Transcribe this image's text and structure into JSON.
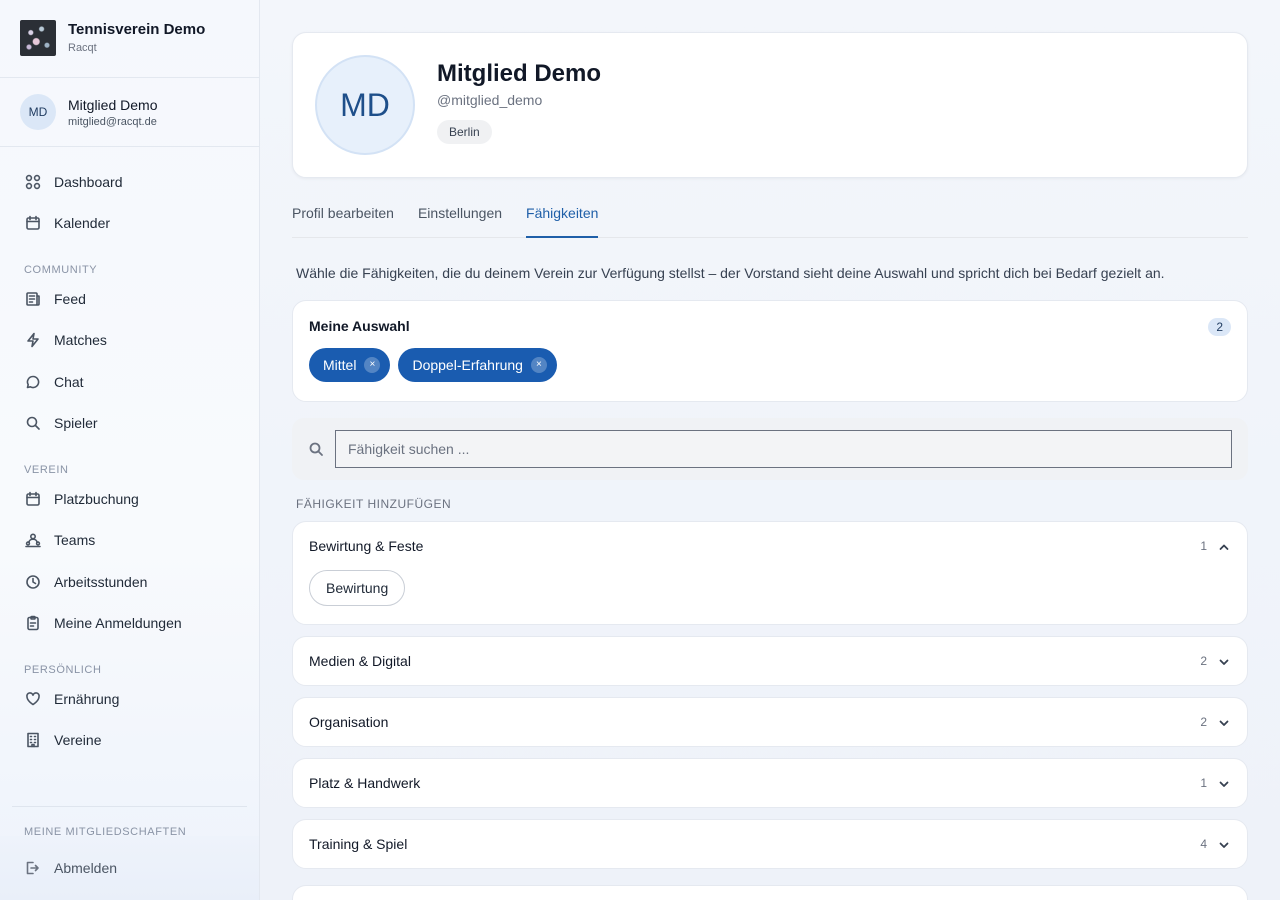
{
  "club": {
    "name": "Tennisverein Demo",
    "sub": "Racqt"
  },
  "user": {
    "initials": "MD",
    "name": "Mitglied Demo",
    "email": "mitglied@racqt.de"
  },
  "nav": {
    "top": [
      {
        "label": "Dashboard",
        "icon": "dashboard-icon"
      },
      {
        "label": "Kalender",
        "icon": "calendar-icon"
      }
    ],
    "community_label": "COMMUNITY",
    "community": [
      {
        "label": "Feed",
        "icon": "feed-icon"
      },
      {
        "label": "Matches",
        "icon": "lightning-icon"
      },
      {
        "label": "Chat",
        "icon": "chat-icon"
      },
      {
        "label": "Spieler",
        "icon": "search-icon"
      }
    ],
    "verein_label": "VEREIN",
    "verein": [
      {
        "label": "Platzbuchung",
        "icon": "calendar-icon"
      },
      {
        "label": "Teams",
        "icon": "teams-icon"
      },
      {
        "label": "Arbeitsstunden",
        "icon": "clock-icon"
      },
      {
        "label": "Meine Anmeldungen",
        "icon": "clipboard-icon"
      }
    ],
    "personal_label": "PERSÖNLICH",
    "personal": [
      {
        "label": "Ernährung",
        "icon": "heart-icon"
      },
      {
        "label": "Vereine",
        "icon": "building-icon"
      }
    ],
    "memberships_label": "MEINE MITGLIEDSCHAFTEN",
    "logout": "Abmelden"
  },
  "profile": {
    "initials": "MD",
    "name": "Mitglied Demo",
    "handle": "@mitglied_demo",
    "city": "Berlin"
  },
  "tabs": [
    {
      "label": "Profil bearbeiten",
      "active": false
    },
    {
      "label": "Einstellungen",
      "active": false
    },
    {
      "label": "Fähigkeiten",
      "active": true
    }
  ],
  "intro": "Wähle die Fähigkeiten, die du deinem Verein zur Verfügung stellst – der Vorstand sieht deine Auswahl und spricht dich bei Bedarf gezielt an.",
  "selection": {
    "title": "Meine Auswahl",
    "count": "2",
    "chips": [
      "Mittel",
      "Doppel-Erfahrung"
    ],
    "remove_glyph": "×"
  },
  "search": {
    "placeholder": "Fähigkeit suchen ..."
  },
  "add_label": "FÄHIGKEIT HINZUFÜGEN",
  "categories": [
    {
      "name": "Bewirtung & Feste",
      "count": "1",
      "expanded": true,
      "options": [
        "Bewirtung"
      ]
    },
    {
      "name": "Medien & Digital",
      "count": "2",
      "expanded": false
    },
    {
      "name": "Organisation",
      "count": "2",
      "expanded": false
    },
    {
      "name": "Platz & Handwerk",
      "count": "1",
      "expanded": false
    },
    {
      "name": "Training & Spiel",
      "count": "4",
      "expanded": false
    }
  ],
  "colors": {
    "accent": "#1a5cb0",
    "tab_active": "#1f5fa8"
  }
}
